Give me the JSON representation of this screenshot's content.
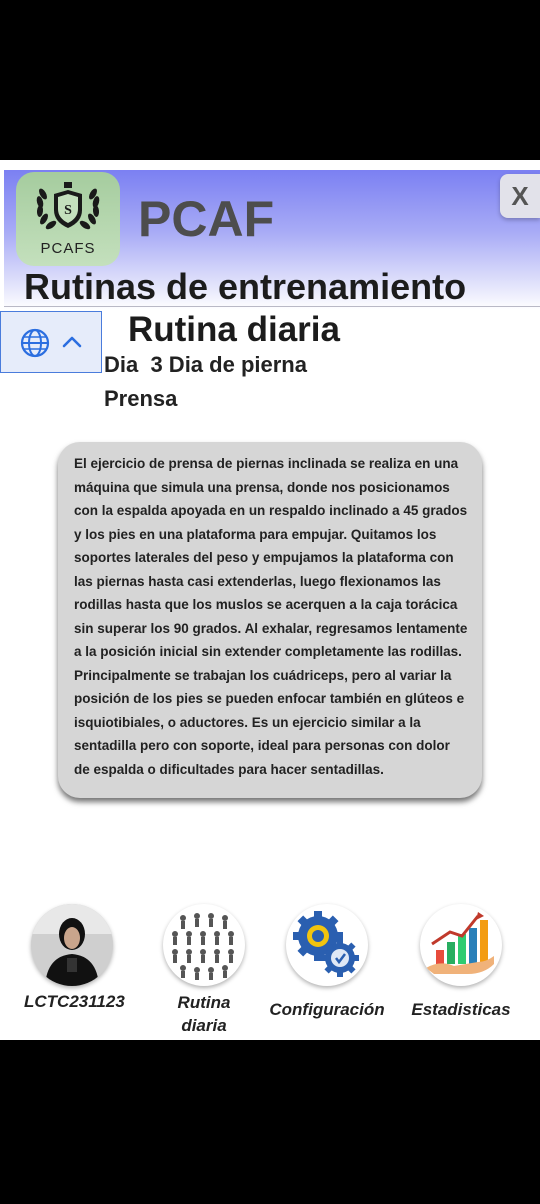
{
  "header": {
    "logo_text": "PCAFS",
    "app_name": "PCAF",
    "close_label": "X"
  },
  "page": {
    "title": "Rutinas de entrenamiento",
    "subtitle": "Rutina diaria",
    "day": "Dia  3 Dia de pierna",
    "exercise": "Prensa"
  },
  "translate_widget": {
    "globe_icon": "globe-icon",
    "chevron_icon": "chevron-up-icon"
  },
  "description": "El ejercicio de prensa de piernas inclinada se realiza en una máquina que simula una prensa, donde nos posicionamos con la espalda apoyada en un respaldo inclinado a 45 grados y los pies en una plataforma para empujar. Quitamos los soportes laterales del peso y empujamos la plataforma con las piernas hasta casi extenderlas, luego flexionamos las rodillas hasta que los muslos se acerquen a la caja torácica sin superar los 90 grados. Al exhalar, regresamos lentamente a la posición inicial sin extender completamente las rodillas. Principalmente se trabajan los cuádriceps, pero al variar la posición de los pies se pueden enfocar también en glúteos e isquiotibiales, o aductores. Es un ejercicio similar a la sentadilla pero con soporte, ideal para personas con dolor de espalda o dificultades para hacer sentadillas.",
  "nav": {
    "profile_label": "LCTC231123",
    "routine_label_1": "Rutina",
    "routine_label_2": "diaria",
    "settings_label": "Configuración",
    "stats_label": "Estadisticas"
  }
}
